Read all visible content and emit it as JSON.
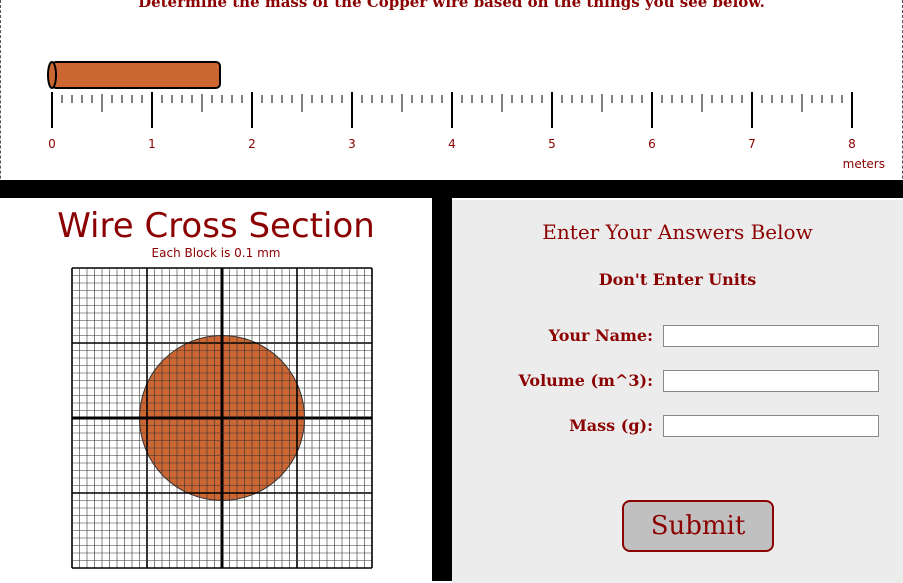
{
  "instruction": "Determine the mass of the Copper wire based on the things you see below.",
  "ruler": {
    "labels": [
      "0",
      "1",
      "2",
      "3",
      "4",
      "5",
      "6",
      "7",
      "8"
    ],
    "unit_label": "meters",
    "wire_length_m": 1.6,
    "wire_color": "#cc6633"
  },
  "cross_section": {
    "title": "Wire Cross Section",
    "subtitle": "Each Block is 0.1 mm",
    "circle_diameter_blocks": 22,
    "grid_blocks": 40,
    "copper_color": "#cc6633"
  },
  "answers": {
    "title": "Enter Your Answers Below",
    "note": "Don't Enter Units",
    "fields": [
      {
        "label": "Your Name:",
        "value": ""
      },
      {
        "label": "Volume (m^3):",
        "value": ""
      },
      {
        "label": "Mass (g):",
        "value": ""
      }
    ],
    "submit_label": "Submit"
  },
  "colors": {
    "accent": "#8b0000",
    "panel_bg": "#ececec"
  }
}
